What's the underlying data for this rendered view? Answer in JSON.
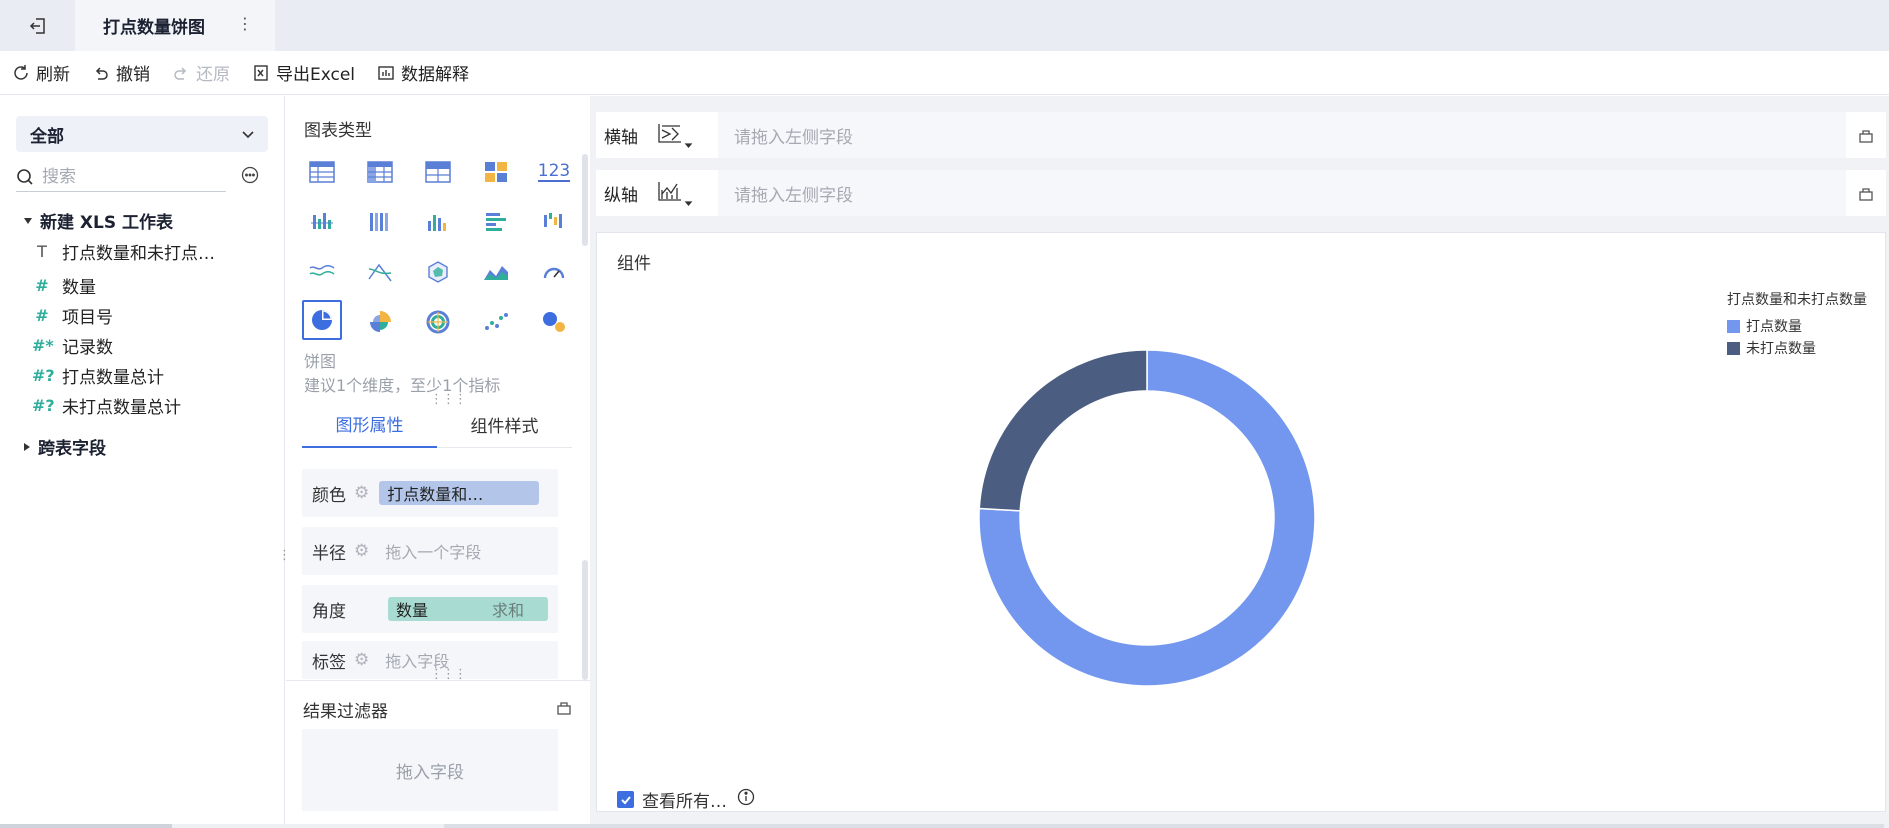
{
  "titlebar": {
    "tab_title": "打点数量饼图"
  },
  "toolbar": {
    "refresh": "刷新",
    "undo": "撤销",
    "redo": "还原",
    "export": "导出Excel",
    "explain": "数据解释"
  },
  "left": {
    "scope": "全部",
    "search_placeholder": "搜索",
    "group1": "新建 XLS 工作表",
    "fields": [
      {
        "icon": "T",
        "label": "打点数量和未打点…"
      },
      {
        "icon": "#",
        "label": "数量"
      },
      {
        "icon": "#",
        "label": "项目号"
      },
      {
        "icon": "#*",
        "label": "记录数"
      },
      {
        "icon": "#?",
        "label": "打点数量总计"
      },
      {
        "icon": "#?",
        "label": "未打点数量总计"
      }
    ],
    "group2": "跨表字段"
  },
  "mid": {
    "chart_type_title": "图表类型",
    "selected_type_name": "饼图",
    "selected_type_hint": "建议1个维度，至少1个指标",
    "tabs": [
      "图形属性",
      "组件样式"
    ],
    "props": {
      "color_label": "颜色",
      "color_value": "打点数量和…",
      "radius_label": "半径",
      "radius_placeholder": "拖入一个字段",
      "angle_label": "角度",
      "angle_field": "数量",
      "angle_agg": "求和",
      "tag_label": "标签",
      "tag_placeholder": "拖入字段"
    },
    "filter_title": "结果过滤器",
    "filter_placeholder": "拖入字段",
    "number_icon_text": "123"
  },
  "right": {
    "x_axis_label": "横轴",
    "y_axis_label": "纵轴",
    "axis_placeholder": "请拖入左侧字段",
    "card_title": "组件",
    "view_all": "查看所有…"
  },
  "colors": {
    "accent": "#3c6ee0",
    "slice1": "#7396ee",
    "slice2": "#4b5d80",
    "teal": "#2fae9c"
  },
  "chart_data": {
    "type": "pie",
    "legend_title": "打点数量和未打点数量",
    "legend_placement": "top-right",
    "donut": true,
    "series": [
      {
        "name": "打点数量",
        "value": 75.9,
        "color": "#7396ee"
      },
      {
        "name": "未打点数量",
        "value": 24.1,
        "color": "#4b5d80"
      }
    ]
  }
}
